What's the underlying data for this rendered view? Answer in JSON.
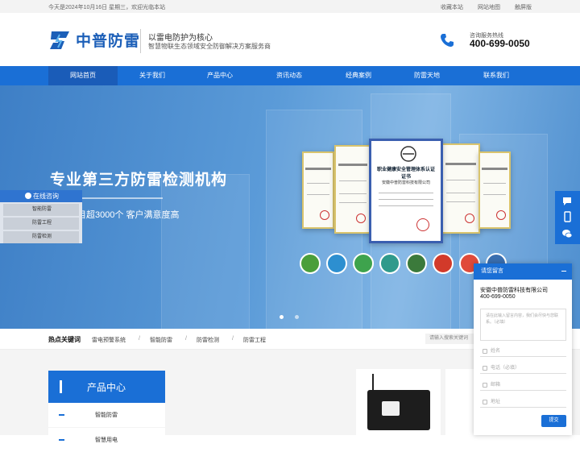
{
  "topbar": {
    "date_text": "今天是2024年10月16日 星期三，欢迎光临本站",
    "links": [
      "收藏本站",
      "网站地图",
      "触屏版"
    ]
  },
  "header": {
    "logo_text": "中普防雷",
    "slogan_main": "以雷电防护为核心",
    "slogan_sub": "智慧物联生态领域安全防御解决方案服务商",
    "hotline_label": "咨询服务热线",
    "hotline_number": "400-699-0050"
  },
  "nav": {
    "items": [
      "网站首页",
      "关于我们",
      "产品中心",
      "资讯动态",
      "经典案例",
      "防雷天地",
      "联系我们"
    ],
    "active_index": 0
  },
  "banner": {
    "title": "专业第三方防雷检测机构",
    "subtitle_partial": "目超3000个  客户满意度高",
    "cert_heading": "职业健康安全管理体系认证证书",
    "cert_company": "安徽中普防雷科技有限公司",
    "slide_count": 2,
    "active_slide": 0
  },
  "consult": {
    "title": "在线咨询",
    "items": [
      "智能防雷",
      "防雷工程",
      "防雷检测"
    ]
  },
  "hot_keywords": {
    "label": "热点关键词",
    "items": [
      "雷电预警系统",
      "智能防雷",
      "防雷检测",
      "防雷工程"
    ],
    "search_placeholder": "请输入搜索关键词"
  },
  "products": {
    "center_title": "产品中心",
    "categories": [
      "智能防雷",
      "智慧用电"
    ]
  },
  "message_panel": {
    "title": "请您留言",
    "company": "安徽中普防雷科技有限公司",
    "phone": "400-699-0050",
    "textarea_placeholder": "请在此输入留言内容，我们会尽快与您联系。（必填）",
    "fields": [
      "姓名",
      "电话（必填）",
      "邮箱",
      "地址"
    ],
    "submit_label": "提交"
  },
  "colors": {
    "brand_blue": "#1a6fd6",
    "nav_active": "#1a5cb8"
  }
}
